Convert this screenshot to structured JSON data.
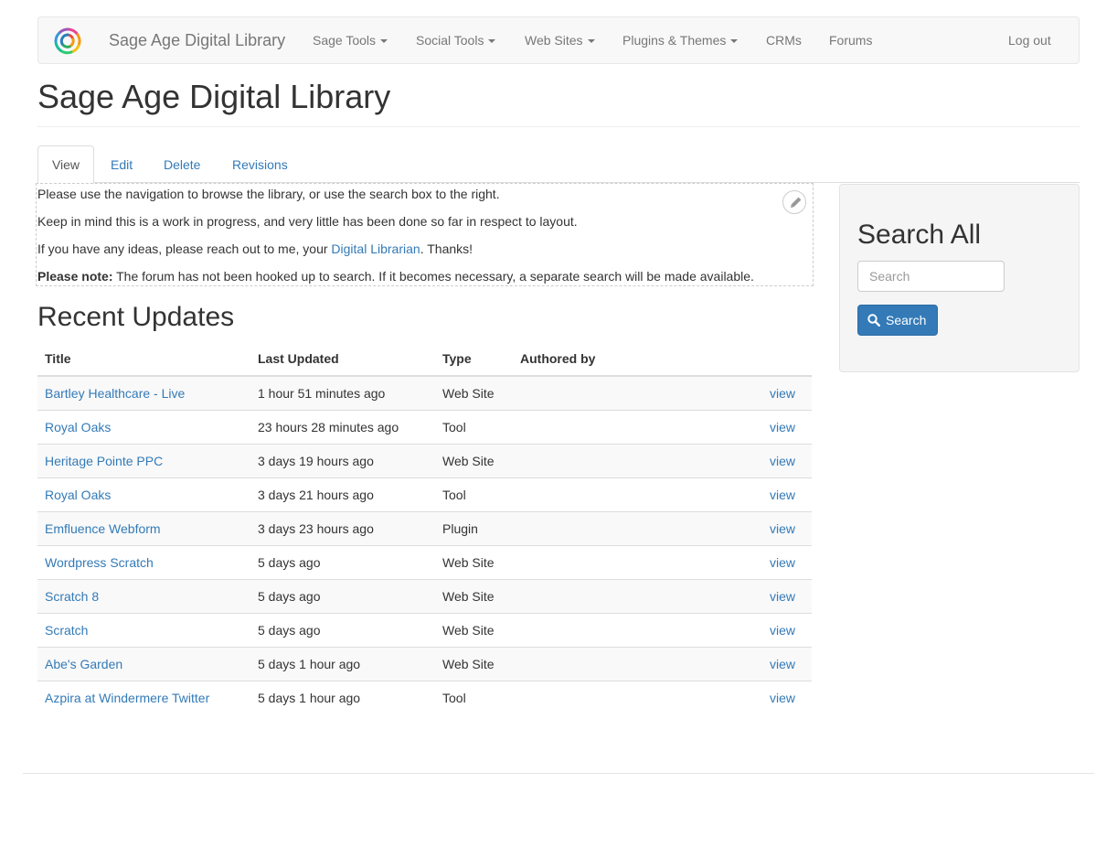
{
  "navbar": {
    "brand": "Sage Age Digital Library",
    "items": [
      {
        "label": "Sage Tools",
        "dropdown": true
      },
      {
        "label": "Social Tools",
        "dropdown": true
      },
      {
        "label": "Web Sites",
        "dropdown": true
      },
      {
        "label": "Plugins & Themes",
        "dropdown": true
      },
      {
        "label": "CRMs",
        "dropdown": false
      },
      {
        "label": "Forums",
        "dropdown": false
      }
    ],
    "logout": "Log out"
  },
  "page": {
    "title": "Sage Age Digital Library"
  },
  "tabs": [
    "View",
    "Edit",
    "Delete",
    "Revisions"
  ],
  "intro": {
    "line1": "Please use the navigation to browse the library, or use the search box to the right.",
    "line2": "Keep in mind this is a work in progress, and very little has been done so far in respect to layout.",
    "line3_prefix": "If you have any ideas, please reach out to me, your ",
    "line3_link": "Digital Librarian",
    "line3_suffix": ". Thanks!",
    "line4_bold": "Please note:",
    "line4_text": " The forum has not been hooked up to search. If it becomes necessary, a separate search will be made available."
  },
  "recent": {
    "title": "Recent Updates",
    "headers": [
      "Title",
      "Last Updated",
      "Type",
      "Authored by"
    ],
    "rows": [
      {
        "title": "Bartley Healthcare - Live",
        "updated": "1 hour 51 minutes ago",
        "type": "Web Site",
        "author": "",
        "action": "view"
      },
      {
        "title": "Royal Oaks",
        "updated": "23 hours 28 minutes ago",
        "type": "Tool",
        "author": "",
        "action": "view"
      },
      {
        "title": "Heritage Pointe PPC",
        "updated": "3 days 19 hours ago",
        "type": "Web Site",
        "author": "",
        "action": "view"
      },
      {
        "title": "Royal Oaks",
        "updated": "3 days 21 hours ago",
        "type": "Tool",
        "author": "",
        "action": "view"
      },
      {
        "title": "Emfluence Webform",
        "updated": "3 days 23 hours ago",
        "type": "Plugin",
        "author": "",
        "action": "view"
      },
      {
        "title": "Wordpress Scratch",
        "updated": "5 days ago",
        "type": "Web Site",
        "author": "",
        "action": "view"
      },
      {
        "title": "Scratch 8",
        "updated": "5 days ago",
        "type": "Web Site",
        "author": "",
        "action": "view"
      },
      {
        "title": "Scratch",
        "updated": "5 days ago",
        "type": "Web Site",
        "author": "",
        "action": "view"
      },
      {
        "title": "Abe's Garden",
        "updated": "5 days 1 hour ago",
        "type": "Web Site",
        "author": "",
        "action": "view"
      },
      {
        "title": "Azpira at Windermere Twitter",
        "updated": "5 days 1 hour ago",
        "type": "Tool",
        "author": "",
        "action": "view"
      }
    ]
  },
  "sidebar": {
    "title": "Search All",
    "search_placeholder": "Search",
    "search_button": "Search"
  },
  "colors": {
    "link": "#337ab7",
    "navbar_bg": "#f8f8f8",
    "primary_button": "#337ab7"
  }
}
